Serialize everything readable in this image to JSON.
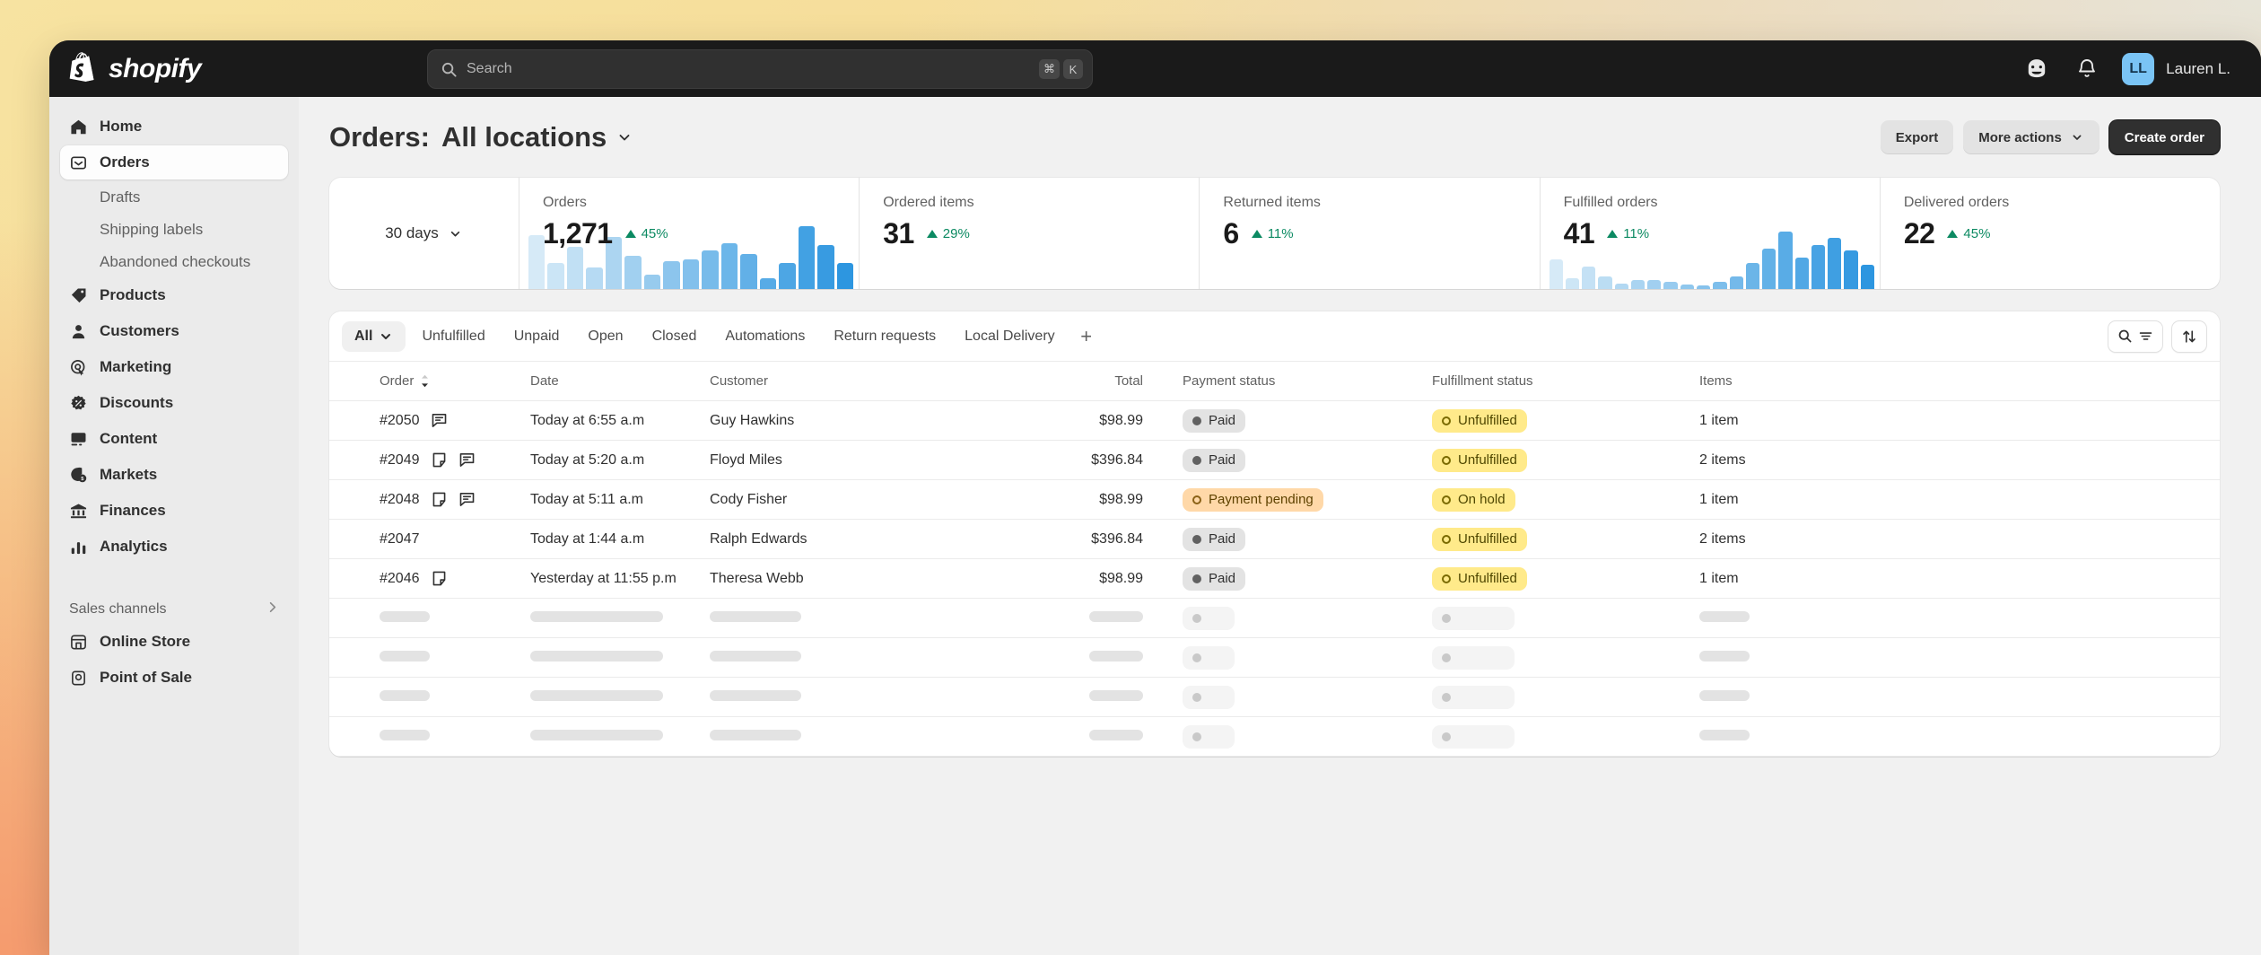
{
  "topbar": {
    "logo_text": "shopify",
    "search_placeholder": "Search",
    "kbd_cmd": "⌘",
    "kbd_key": "K",
    "user_initials": "LL",
    "user_name": "Lauren L.",
    "icons": [
      "shopify-inbox-icon",
      "bell-icon"
    ]
  },
  "sidebar": {
    "items": [
      {
        "label": "Home",
        "icon": "home-icon",
        "type": "main",
        "active": false
      },
      {
        "label": "Orders",
        "icon": "orders-icon",
        "type": "main",
        "active": true
      },
      {
        "label": "Drafts",
        "icon": "",
        "type": "sub",
        "active": false
      },
      {
        "label": "Shipping labels",
        "icon": "",
        "type": "sub",
        "active": false
      },
      {
        "label": "Abandoned checkouts",
        "icon": "",
        "type": "sub",
        "active": false
      },
      {
        "label": "Products",
        "icon": "tag-icon",
        "type": "main",
        "active": false
      },
      {
        "label": "Customers",
        "icon": "person-icon",
        "type": "main",
        "active": false
      },
      {
        "label": "Marketing",
        "icon": "target-icon",
        "type": "main",
        "active": false
      },
      {
        "label": "Discounts",
        "icon": "discount-icon",
        "type": "main",
        "active": false
      },
      {
        "label": "Content",
        "icon": "content-icon",
        "type": "main",
        "active": false
      },
      {
        "label": "Markets",
        "icon": "markets-icon",
        "type": "main",
        "active": false
      },
      {
        "label": "Finances",
        "icon": "bank-icon",
        "type": "main",
        "active": false
      },
      {
        "label": "Analytics",
        "icon": "analytics-icon",
        "type": "main",
        "active": false
      }
    ],
    "section_label": "Sales channels",
    "channels": [
      {
        "label": "Online Store",
        "icon": "store-icon"
      },
      {
        "label": "Point of Sale",
        "icon": "pos-icon"
      }
    ]
  },
  "header": {
    "title_label": "Orders:",
    "location": "All locations",
    "export_label": "Export",
    "more_actions_label": "More actions",
    "create_order_label": "Create order"
  },
  "metrics": {
    "range_label": "30 days",
    "cards": [
      {
        "label": "Orders",
        "value": "1,271",
        "delta": "45%",
        "direction": "up",
        "has_chart": true
      },
      {
        "label": "Ordered items",
        "value": "31",
        "delta": "29%",
        "direction": "up",
        "has_chart": false
      },
      {
        "label": "Returned items",
        "value": "6",
        "delta": "11%",
        "direction": "up",
        "has_chart": false
      },
      {
        "label": "Fulfilled orders",
        "value": "41",
        "delta": "11%",
        "direction": "up",
        "has_chart": true
      },
      {
        "label": "Delivered orders",
        "value": "22",
        "delta": "45%",
        "direction": "up",
        "has_chart": false
      }
    ]
  },
  "chart_data": [
    {
      "type": "bar",
      "title": "Orders",
      "xlabel": "",
      "ylabel": "",
      "values": [
        62,
        30,
        48,
        25,
        60,
        38,
        16,
        32,
        34,
        44,
        52,
        40,
        12,
        30,
        72,
        50,
        30
      ],
      "categories": [
        "1",
        "2",
        "3",
        "4",
        "5",
        "6",
        "7",
        "8",
        "9",
        "10",
        "11",
        "12",
        "13",
        "14",
        "15",
        "16",
        "17"
      ],
      "ylim": [
        0,
        80
      ],
      "grid": false,
      "legend": "none"
    },
    {
      "type": "bar",
      "title": "Fulfilled orders",
      "xlabel": "",
      "ylabel": "",
      "values": [
        34,
        12,
        26,
        14,
        6,
        10,
        10,
        8,
        5,
        4,
        8,
        14,
        30,
        46,
        66,
        36,
        50,
        58,
        44,
        28
      ],
      "categories": [
        "1",
        "2",
        "3",
        "4",
        "5",
        "6",
        "7",
        "8",
        "9",
        "10",
        "11",
        "12",
        "13",
        "14",
        "15",
        "16",
        "17",
        "18",
        "19",
        "20"
      ],
      "ylim": [
        0,
        80
      ],
      "grid": false,
      "legend": "none"
    }
  ],
  "filters": {
    "tabs": [
      "All",
      "Unfulfilled",
      "Unpaid",
      "Open",
      "Closed",
      "Automations",
      "Return requests",
      "Local Delivery"
    ],
    "active_tab": "All",
    "add_label": "+"
  },
  "table": {
    "columns": [
      "Order",
      "Date",
      "Customer",
      "Total",
      "Payment status",
      "Fulfillment status",
      "Items"
    ],
    "sorted_column": "Order",
    "rows": [
      {
        "order": "#2050",
        "icons": [
          "chat-icon"
        ],
        "date": "Today at 6:55 a.m",
        "customer": "Guy Hawkins",
        "total": "$98.99",
        "payment": "Paid",
        "payment_style": "paid",
        "fulfillment": "Unfulfilled",
        "fulfillment_style": "unfulfilled",
        "items": "1 item"
      },
      {
        "order": "#2049",
        "icons": [
          "note-icon",
          "chat-icon"
        ],
        "date": "Today at 5:20 a.m",
        "customer": "Floyd Miles",
        "total": "$396.84",
        "payment": "Paid",
        "payment_style": "paid",
        "fulfillment": "Unfulfilled",
        "fulfillment_style": "unfulfilled",
        "items": "2 items"
      },
      {
        "order": "#2048",
        "icons": [
          "note-icon",
          "chat-icon"
        ],
        "date": "Today at 5:11 a.m",
        "customer": "Cody Fisher",
        "total": "$98.99",
        "payment": "Payment pending",
        "payment_style": "pending",
        "fulfillment": "On hold",
        "fulfillment_style": "onhold",
        "items": "1 item"
      },
      {
        "order": "#2047",
        "icons": [],
        "date": "Today at 1:44 a.m",
        "customer": "Ralph Edwards",
        "total": "$396.84",
        "payment": "Paid",
        "payment_style": "paid",
        "fulfillment": "Unfulfilled",
        "fulfillment_style": "unfulfilled",
        "items": "2 items"
      },
      {
        "order": "#2046",
        "icons": [
          "note-icon"
        ],
        "date": "Yesterday at 11:55 p.m",
        "customer": "Theresa Webb",
        "total": "$98.99",
        "payment": "Paid",
        "payment_style": "paid",
        "fulfillment": "Unfulfilled",
        "fulfillment_style": "unfulfilled",
        "items": "1 item"
      }
    ],
    "skeleton_rows": 4
  },
  "colors": {
    "brand_dark": "#1a1a1a",
    "accent_blue": "#3b9fe0",
    "positive_green": "#0c8a62",
    "badge_yellow": "#ffea8a",
    "badge_orange": "#ffd8a8",
    "avatar_blue": "#7ac4f5"
  }
}
